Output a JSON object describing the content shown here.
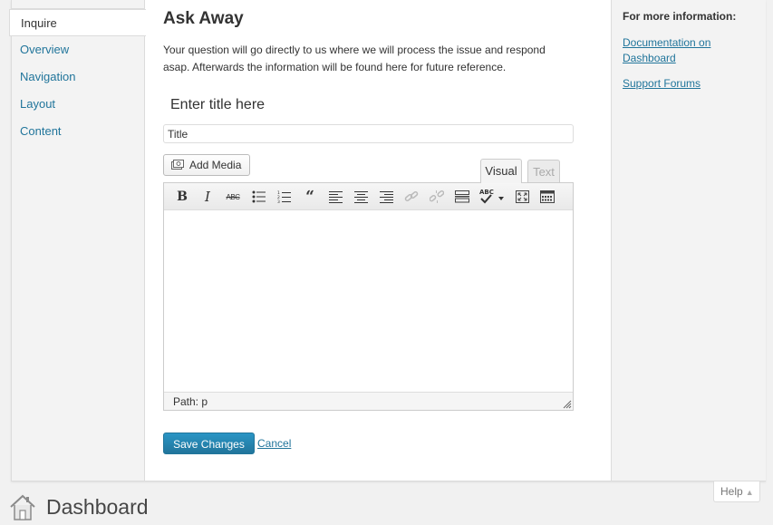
{
  "help": {
    "tabs": [
      {
        "label": "Inquire"
      },
      {
        "label": "Overview"
      },
      {
        "label": "Navigation"
      },
      {
        "label": "Layout"
      },
      {
        "label": "Content"
      }
    ],
    "heading": "Ask Away",
    "intro": "Your question will go directly to us where we will process the issue and respond asap. Afterwards the information will be found here for future reference.",
    "title_label": "Enter title here",
    "title_value": "Title",
    "add_media_label": "Add Media",
    "editor_tabs": {
      "visual": "Visual",
      "text": "Text"
    },
    "status_path": "Path: p",
    "save_label": "Save Changes",
    "cancel_label": "Cancel",
    "sidebar": {
      "heading": "For more information:",
      "links": [
        "Documentation on Dashboard",
        "Support Forums"
      ]
    },
    "help_tab_label": "Help",
    "help_tab_caret": "▲"
  },
  "page": {
    "title": "Dashboard"
  },
  "colors": {
    "link": "#21759b",
    "primary_button": "#21759b",
    "panel_bg": "#ffffff",
    "page_bg": "#f1f1f1"
  },
  "icons": {
    "toolbar": [
      "bold-icon",
      "italic-icon",
      "strikethrough-icon",
      "bullet-list-icon",
      "numbered-list-icon",
      "blockquote-icon",
      "align-left-icon",
      "align-center-icon",
      "align-right-icon",
      "insert-link-icon",
      "unlink-icon",
      "read-more-icon",
      "spellcheck-icon",
      "fullscreen-icon",
      "kitchen-sink-icon"
    ],
    "dashboard": "home-icon",
    "media": "camera-icon"
  }
}
